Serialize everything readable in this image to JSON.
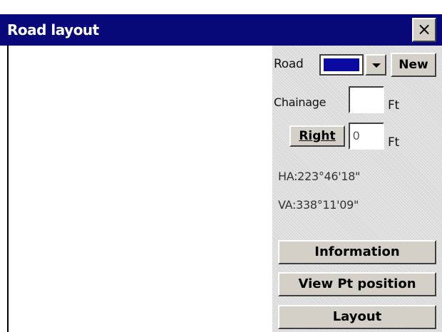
{
  "window": {
    "title": "Road layout",
    "close_label": "×"
  },
  "form": {
    "road_label": "Road",
    "road_value": "",
    "new_button": "New",
    "chainage_label": "Chainage",
    "chainage_value": "",
    "chainage_unit": "Ft",
    "offset_button": "Right",
    "offset_value": "0",
    "offset_unit": "Ft"
  },
  "readout": {
    "ha": "HA:223°46'18\"",
    "va": "VA:338°11'09\""
  },
  "actions": {
    "information": "Information",
    "view_pt_position": "View Pt position",
    "layout": "Layout"
  },
  "colors": {
    "titlebar": "#08087a",
    "panel": "#dadada",
    "selection": "#0a0aa0"
  }
}
